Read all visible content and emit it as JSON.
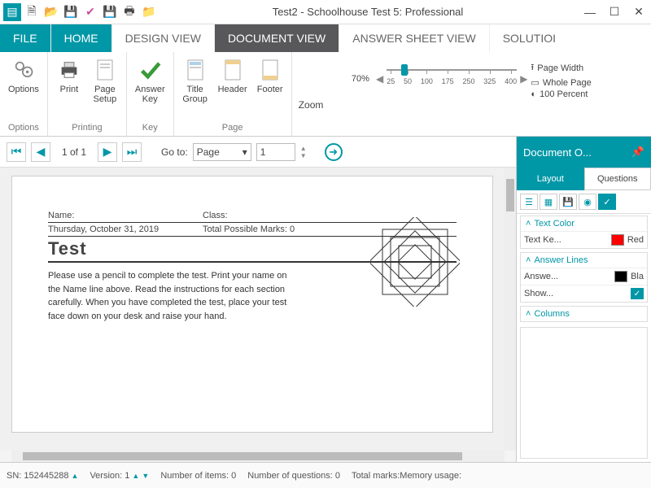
{
  "title": "Test2 - Schoolhouse Test 5: Professional",
  "tabs": {
    "file": "FILE",
    "home": "HOME",
    "design": "DESIGN VIEW",
    "document": "DOCUMENT VIEW",
    "answer": "ANSWER SHEET VIEW",
    "solution": "SOLUTIOI"
  },
  "ribbon": {
    "options": {
      "label": "Options",
      "group": "Options"
    },
    "print": {
      "label": "Print"
    },
    "pagesetup": {
      "label1": "Page",
      "label2": "Setup"
    },
    "printing_group": "Printing",
    "answerkey": {
      "label1": "Answer",
      "label2": "Key"
    },
    "key_group": "Key",
    "titlegroup": {
      "label1": "Title",
      "label2": "Group"
    },
    "header": "Header",
    "footer": "Footer",
    "page_group": "Page",
    "zoom": {
      "pct": "70%",
      "ticks": [
        "25",
        "50",
        "100",
        "175",
        "250",
        "325",
        "400"
      ],
      "pageWidth": "Page Width",
      "wholePage": "Whole Page",
      "hundred": "100 Percent",
      "group": "Zoom"
    }
  },
  "nav": {
    "pageOf": "1 of 1",
    "gotoLabel": "Go to:",
    "gotoSel": "Page",
    "gotoNum": "1"
  },
  "doc": {
    "nameLabel": "Name:",
    "classLabel": "Class:",
    "date": "Thursday, October 31, 2019",
    "marks": "Total Possible Marks: 0",
    "title": "Test",
    "instructions": "Please use a pencil to complete the test. Print your name on the Name line above. Read the instructions for each section carefully. When you have completed the test, place your test face down on your desk and raise your hand."
  },
  "side": {
    "header": "Document  O...",
    "tab_layout": "Layout",
    "tab_questions": "Questions",
    "sec_textcolor": "Text Color",
    "prop_textkey": "Text Ke...",
    "val_red": "Red",
    "sec_answerlines": "Answer Lines",
    "prop_answer": "Answe...",
    "val_bla": "Bla",
    "prop_show": "Show...",
    "sec_columns": "Columns"
  },
  "status": {
    "sn": "SN:  152445288",
    "version": "Version: 1",
    "items": "Number of items: 0",
    "questions": "Number of questions: 0",
    "marks": "Total marks:",
    "memory": "Memory usage:"
  }
}
